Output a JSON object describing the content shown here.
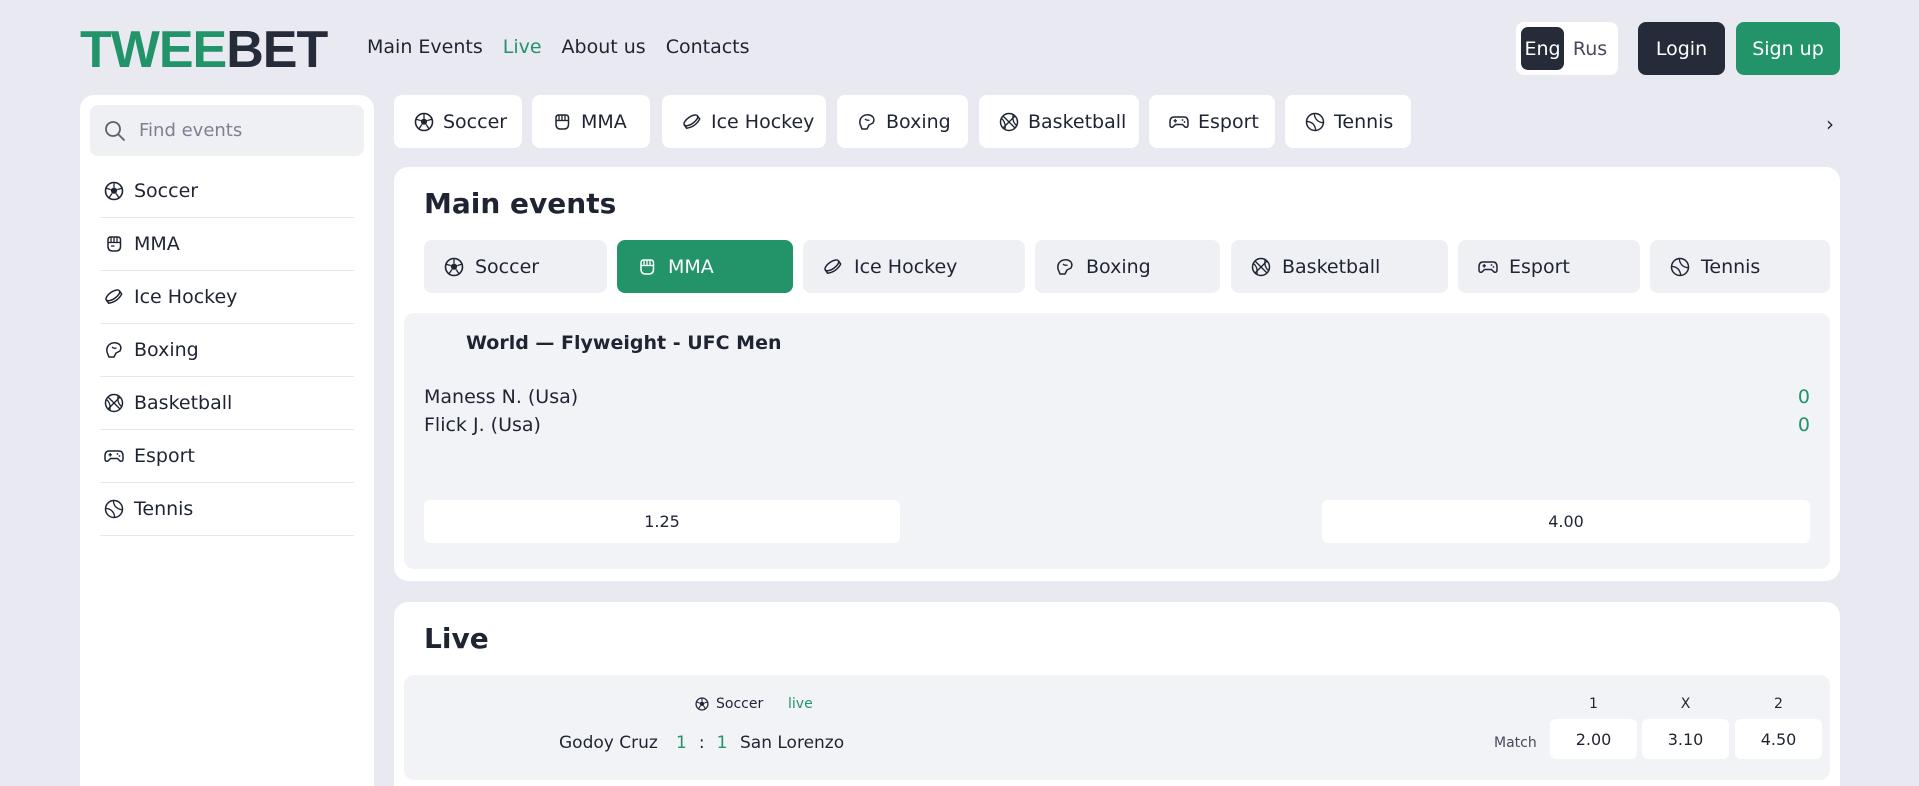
{
  "brand": {
    "part1": "TWEE",
    "part2": "BET",
    "accent": "#23936a",
    "dark": "#262b3a"
  },
  "nav": [
    {
      "label": "Main Events",
      "active": false
    },
    {
      "label": "Live",
      "active": true
    },
    {
      "label": "About us",
      "active": false
    },
    {
      "label": "Contacts",
      "active": false
    }
  ],
  "lang": {
    "selected": "Eng",
    "other": "Rus"
  },
  "auth": {
    "login": "Login",
    "signup": "Sign up"
  },
  "search": {
    "placeholder": "Find events",
    "value": ""
  },
  "sports": [
    {
      "label": "Soccer",
      "icon": "soccer-ball-icon"
    },
    {
      "label": "MMA",
      "icon": "fist-icon"
    },
    {
      "label": "Ice Hockey",
      "icon": "hockey-puck-icon"
    },
    {
      "label": "Boxing",
      "icon": "boxing-glove-icon"
    },
    {
      "label": "Basketball",
      "icon": "basketball-icon"
    },
    {
      "label": "Esport",
      "icon": "gamepad-icon"
    },
    {
      "label": "Tennis",
      "icon": "tennis-ball-icon"
    }
  ],
  "top_more": "›",
  "main_events": {
    "title": "Main events",
    "active_filter": "MMA",
    "event": {
      "league": "World — Flyweight - UFC Men",
      "home": {
        "name": "Maness N. (Usa)",
        "score": "0"
      },
      "away": {
        "name": "Flick J. (Usa)",
        "score": "0"
      },
      "odds": [
        "1.25",
        "4.00"
      ]
    }
  },
  "live": {
    "title": "Live",
    "row": {
      "sport": "Soccer",
      "status": "live",
      "home": "Godoy Cruz",
      "home_score": "1",
      "separator": ":",
      "away_score": "1",
      "away": "San Lorenzo",
      "market": "Match",
      "headers": [
        "1",
        "X",
        "2"
      ],
      "odds": [
        "2.00",
        "3.10",
        "4.50"
      ]
    }
  }
}
